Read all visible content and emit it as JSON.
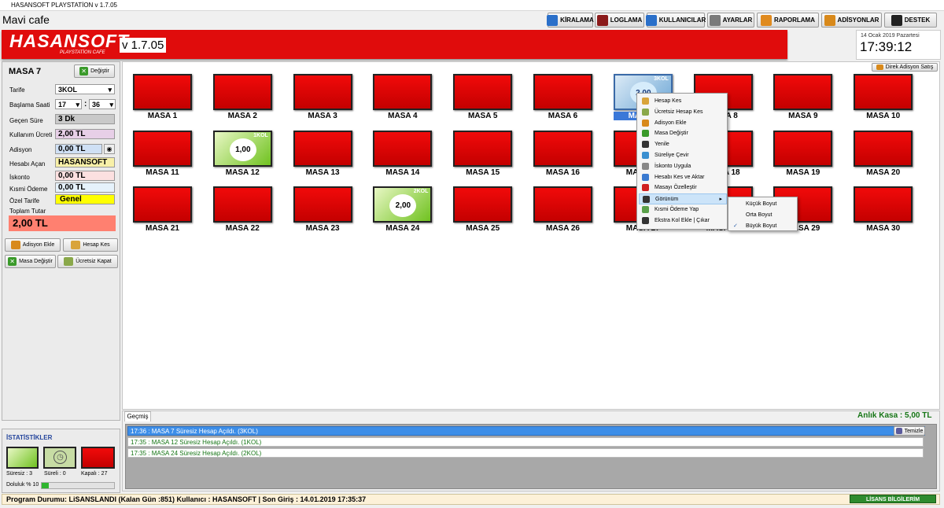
{
  "window": {
    "title": "HASANSOFT PLAYSTATİON v 1.7.05"
  },
  "cafe_name": "Mavi cafe",
  "toolbar": [
    {
      "label": "KİRALAMA",
      "icon": "house-icon",
      "color": "#2a6fc9"
    },
    {
      "label": "LOGLAMA",
      "icon": "log-book-icon",
      "color": "#8b1a1a"
    },
    {
      "label": "KULLANICILAR",
      "icon": "users-icon",
      "color": "#2a6fc9"
    },
    {
      "label": "AYARLAR",
      "icon": "tools-icon",
      "color": "#7a7a7a"
    },
    {
      "label": "RAPORLAMA",
      "icon": "pie-chart-icon",
      "color": "#e08a1e"
    },
    {
      "label": "ADİSYONLAR",
      "icon": "burger-icon",
      "color": "#d8891b"
    },
    {
      "label": "DESTEK",
      "icon": "telephone-icon",
      "color": "#222222"
    }
  ],
  "banner": {
    "logo": "HASANSOFT",
    "logo_sub": "PLAYSTATİON CAFE",
    "version": "v 1.7.05",
    "color": "#e00c0c"
  },
  "clock": {
    "date": "14 Ocak 2019 Pazartesi",
    "time": "17:39:12"
  },
  "left": {
    "title": "MASA 7",
    "degistir": "Değiştir",
    "tarife_label": "Tarife",
    "tarife_value": "3KOL",
    "baslama_label": "Başlama Saati",
    "hour": "17",
    "sep": ":",
    "minute": "36",
    "gecen_label": "Geçen Süre",
    "gecen_value": "3 Dk",
    "kullanim_label": "Kullanım Ücreti",
    "kullanim_value": "2,00 TL",
    "adisyon_label": "Adisyon",
    "adisyon_value": "0,00 TL",
    "hesabi_acan_label": "Hesabı Açan",
    "hesabi_acan_value": "HASANSOFT",
    "iskonto_label": "İskonto",
    "iskonto_value": "0,00 TL",
    "kismi_label": "Kısmi Ödeme",
    "kismi_value": "0,00 TL",
    "ozel_label": "Özel Tarife",
    "ozel_value": "Genel",
    "toplam_label": "Toplam Tutar",
    "toplam_value": "2,00 TL",
    "btn_adisyon": "Adisyon Ekle",
    "btn_hesap": "Hesap Kes",
    "btn_masa": "Masa Değiştir",
    "btn_ucretsiz": "Ücretsiz Kapat"
  },
  "direk_adisyon": "Direk Adisyon Satış",
  "tables": [
    {
      "name": "MASA 1",
      "state": "closed"
    },
    {
      "name": "MASA 2",
      "state": "closed"
    },
    {
      "name": "MASA 3",
      "state": "closed"
    },
    {
      "name": "MASA 4",
      "state": "closed"
    },
    {
      "name": "MASA 5",
      "state": "closed"
    },
    {
      "name": "MASA 6",
      "state": "closed"
    },
    {
      "name": "MASA 7",
      "state": "selected",
      "amount": "2,00",
      "kol": "3KOL"
    },
    {
      "name": "MASA 8",
      "state": "closed"
    },
    {
      "name": "MASA 9",
      "state": "closed"
    },
    {
      "name": "MASA 10",
      "state": "closed"
    },
    {
      "name": "MASA 11",
      "state": "closed"
    },
    {
      "name": "MASA 12",
      "state": "active",
      "amount": "1,00",
      "kol": "1KOL"
    },
    {
      "name": "MASA 13",
      "state": "closed"
    },
    {
      "name": "MASA 14",
      "state": "closed"
    },
    {
      "name": "MASA 15",
      "state": "closed"
    },
    {
      "name": "MASA 16",
      "state": "closed"
    },
    {
      "name": "MASA 17",
      "state": "closed"
    },
    {
      "name": "MASA 18",
      "state": "closed"
    },
    {
      "name": "MASA 19",
      "state": "closed"
    },
    {
      "name": "MASA 20",
      "state": "closed"
    },
    {
      "name": "MASA 21",
      "state": "closed"
    },
    {
      "name": "MASA 22",
      "state": "closed"
    },
    {
      "name": "MASA 23",
      "state": "closed"
    },
    {
      "name": "MASA 24",
      "state": "active",
      "amount": "2,00",
      "kol": "2KOL"
    },
    {
      "name": "MASA 25",
      "state": "closed"
    },
    {
      "name": "MASA 26",
      "state": "closed"
    },
    {
      "name": "MASA 27",
      "state": "closed"
    },
    {
      "name": "MASA 28",
      "state": "closed"
    },
    {
      "name": "MASA 29",
      "state": "closed"
    },
    {
      "name": "MASA 30",
      "state": "closed"
    }
  ],
  "context_menu": [
    {
      "label": "Hesap Kes",
      "icon": "cash-icon",
      "color": "#d9a43a"
    },
    {
      "label": "Ücretsiz Hesap Kes",
      "icon": "free-cash-icon",
      "color": "#8aa84a"
    },
    {
      "label": "Adisyon Ekle",
      "icon": "burger-icon",
      "color": "#d8891b"
    },
    {
      "label": "Masa Değiştir",
      "icon": "swap-icon",
      "color": "#3a9a2a"
    },
    {
      "label": "Yenile",
      "icon": "refresh-icon",
      "color": "#333333"
    },
    {
      "label": "Süreliye Çevir",
      "icon": "clock-icon",
      "color": "#3a8fd0"
    },
    {
      "label": "İskonto Uygula",
      "icon": "percent-icon",
      "color": "#888888"
    },
    {
      "label": "Hesabı Kes ve Aktar",
      "icon": "transfer-icon",
      "color": "#3a7ad0"
    },
    {
      "label": "Masayı Özelleştir",
      "icon": "star-icon",
      "color": "#d02020"
    },
    {
      "label": "Görünüm",
      "icon": "grid-icon",
      "color": "#333333",
      "submenu": true
    },
    {
      "label": "Kısmi Ödeme Yap",
      "icon": "partial-pay-icon",
      "color": "#5aa04a"
    },
    {
      "label": "Ekstra Kol Ekle | Çıkar",
      "icon": "gamepad-icon",
      "color": "#333333"
    }
  ],
  "sub_menu": [
    {
      "label": "Küçük Boyut",
      "checked": false
    },
    {
      "label": "Orta Boyut",
      "checked": false
    },
    {
      "label": "Büyük Boyut",
      "checked": true
    }
  ],
  "history": {
    "tab": "Geçmiş",
    "kasa": "Anlık Kasa : 5,00 TL",
    "clear": "Temizle",
    "rows": [
      "17:36 : MASA 7 Süresiz Hesap Açıldı. (3KOL)",
      "17:35 : MASA 12 Süresiz Hesap Açıldı. (1KOL)",
      "17:35 : MASA 24 Süresiz Hesap Açıldı. (2KOL)"
    ]
  },
  "stats": {
    "title": "İSTATİSTİKLER",
    "suresiz": "Süresiz : 3",
    "sureli": "Süreli : 0",
    "kapali": "Kapalı : 27",
    "doluluk": "Doluluk % 10",
    "doluluk_fraction": 0.1
  },
  "status": {
    "text": "Program Durumu: LiSANSLANDI (Kalan Gün :851)       Kullanıcı : HASANSOFT | Son Giriş : 14.01.2019 17:35:37",
    "lisans": "LİSANS BİLGİLERİM"
  }
}
